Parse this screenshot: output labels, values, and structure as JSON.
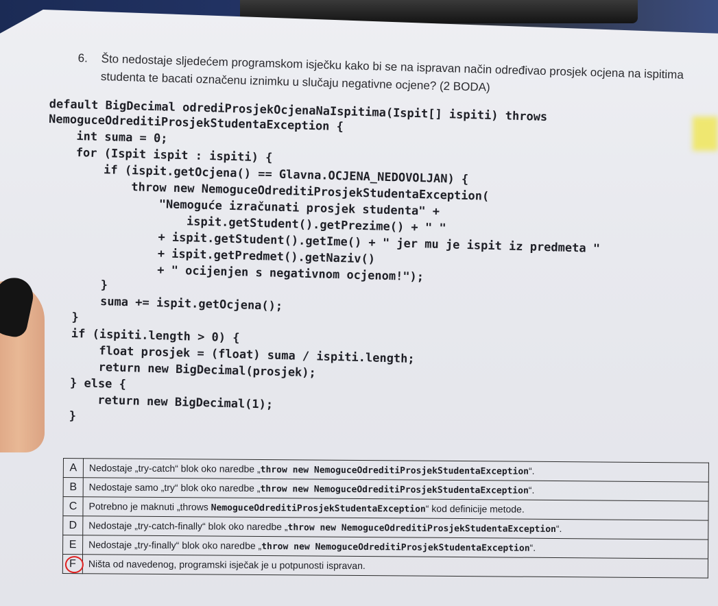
{
  "question": {
    "number": "6.",
    "text": "Što nedostaje sljedećem programskom isječku kako bi se na ispravan način određivao prosjek ocjena na ispitima studenta te bacati označenu iznimku u slučaju negativne ocjene? (2 BODA)"
  },
  "code_lines": [
    "default BigDecimal odrediProsjekOcjenaNaIspitima(Ispit[] ispiti) throws",
    "NemoguceOdreditiProsjekStudentaException {",
    "    int suma = 0;",
    "    for (Ispit ispit : ispiti) {",
    "        if (ispit.getOcjena() == Glavna.OCJENA_NEDOVOLJAN) {",
    "            throw new NemoguceOdreditiProsjekStudentaException(",
    "                \"Nemoguće izračunati prosjek studenta\" +",
    "                    ispit.getStudent().getPrezime() + \" \"",
    "                + ispit.getStudent().getIme() + \" jer mu je ispit iz predmeta \"",
    "                + ispit.getPredmet().getNaziv()",
    "                + \" ocijenjen s negativnom ocjenom!\");",
    "        }",
    "        suma += ispit.getOcjena();",
    "    }",
    "    if (ispiti.length > 0) {",
    "        float prosjek = (float) suma / ispiti.length;",
    "        return new BigDecimal(prosjek);",
    "    } else {",
    "        return new BigDecimal(1);",
    "    }",
    "}"
  ],
  "answers": [
    {
      "letter": "A",
      "pre": "Nedostaje „try-catch“ blok oko naredbe „",
      "code": "throw new NemoguceOdreditiProsjekStudentaException",
      "post": "“."
    },
    {
      "letter": "B",
      "pre": "Nedostaje samo „try“ blok oko naredbe „",
      "code": "throw new NemoguceOdreditiProsjekStudentaException",
      "post": "“."
    },
    {
      "letter": "C",
      "pre": "Potrebno je maknuti „throws ",
      "code": "NemoguceOdreditiProsjekStudentaException",
      "post": "“ kod definicije metode."
    },
    {
      "letter": "D",
      "pre": "Nedostaje „try-catch-finally“ blok oko naredbe „",
      "code": "throw new NemoguceOdreditiProsjekStudentaException",
      "post": "“."
    },
    {
      "letter": "E",
      "pre": "Nedostaje „try-finally“ blok oko naredbe „",
      "code": "throw new NemoguceOdreditiProsjekStudentaException",
      "post": "“."
    },
    {
      "letter": "F",
      "pre": "Ništa od navedenog, programski isječak je u potpunosti ispravan.",
      "code": "",
      "post": ""
    }
  ],
  "selected_answer": "F",
  "colors": {
    "selection_circle": "#e02020"
  }
}
